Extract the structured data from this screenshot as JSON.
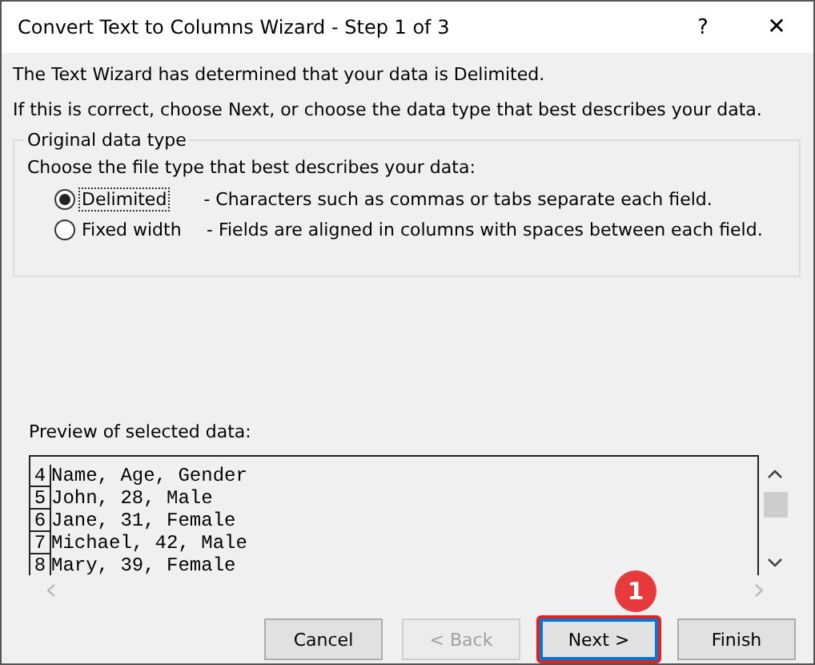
{
  "window": {
    "title": "Convert Text to Columns Wizard - Step 1 of 3",
    "help": "?",
    "close": "✕"
  },
  "intro": [
    "The Text Wizard has determined that your data is Delimited.",
    "If this is correct, choose Next, or choose the data type that best describes your data."
  ],
  "group": {
    "title": "Original data type",
    "prompt": "Choose the file type that best describes your data:",
    "options": [
      {
        "label": "Delimited",
        "description": "- Characters such as commas or tabs separate each field.",
        "selected": true
      },
      {
        "label": "Fixed width",
        "description": "- Fields are aligned in columns with spaces between each field.",
        "selected": false
      }
    ]
  },
  "preview": {
    "label": "Preview of selected data:",
    "rows": [
      {
        "number": "4",
        "text": "Name, Age, Gender"
      },
      {
        "number": "5",
        "text": "John, 28, Male"
      },
      {
        "number": "6",
        "text": "Jane, 31, Female"
      },
      {
        "number": "7",
        "text": "Michael, 42, Male"
      },
      {
        "number": "8",
        "text": "Mary, 39, Female"
      }
    ]
  },
  "callout": "1",
  "buttons": [
    {
      "label": "Cancel",
      "disabled": false,
      "highlighted": false
    },
    {
      "label": "< Back",
      "disabled": true,
      "highlighted": false
    },
    {
      "label": "Next >",
      "disabled": false,
      "highlighted": true
    },
    {
      "label": "Finish",
      "disabled": false,
      "highlighted": false
    }
  ]
}
